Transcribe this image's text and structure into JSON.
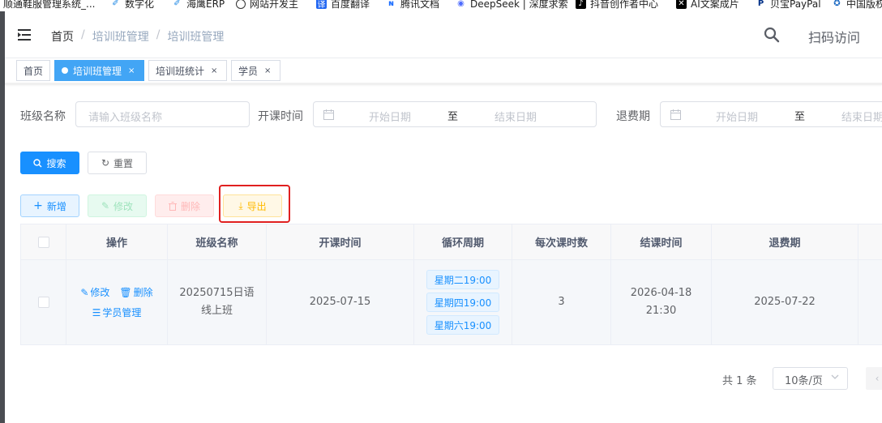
{
  "bookmarks": [
    {
      "label": "顺通鞋服管理系统_...",
      "icon": "site-icon",
      "color": "#444"
    },
    {
      "label": "数字化",
      "icon": "feather-icon",
      "color": "#1e88e5"
    },
    {
      "label": "海鹰ERP",
      "icon": "feather-icon",
      "color": "#1e88e5"
    },
    {
      "label": "网站开发主",
      "icon": "globe-icon",
      "color": "#333"
    },
    {
      "label": "百度翻译",
      "icon": "translate-icon",
      "color": "#2468f2"
    },
    {
      "label": "腾讯文档",
      "icon": "doc-icon",
      "color": "#1e6fff"
    },
    {
      "label": "DeepSeek | 深度求索",
      "icon": "deepseek-icon",
      "color": "#4d6bfe"
    },
    {
      "label": "抖音创作者中心",
      "icon": "tiktok-icon",
      "color": "#000"
    },
    {
      "label": "AI文案成片",
      "icon": "capcut-icon",
      "color": "#000"
    },
    {
      "label": "贝宝PayPal",
      "icon": "paypal-icon",
      "color": "#003087"
    },
    {
      "label": "中国版权",
      "icon": "seal-icon",
      "color": "#1565c0"
    }
  ],
  "navbar": {
    "breadcrumb": [
      "首页",
      "培训班管理",
      "培训班管理"
    ],
    "scan_label": "扫码访问"
  },
  "tags": [
    {
      "label": "首页",
      "active": false,
      "closable": false
    },
    {
      "label": "培训班管理",
      "active": true,
      "closable": true
    },
    {
      "label": "培训班统计",
      "active": false,
      "closable": true
    },
    {
      "label": "学员",
      "active": false,
      "closable": true
    }
  ],
  "tag_close_glyph": "×",
  "filters": {
    "class_name_label": "班级名称",
    "class_name_placeholder": "请输入班级名称",
    "start_time_label": "开课时间",
    "refund_label": "退费期",
    "start_date_placeholder": "开始日期",
    "end_date_placeholder": "结束日期",
    "range_separator": "至"
  },
  "buttons": {
    "search": "搜索",
    "reset": "重置",
    "add": "新增",
    "edit": "修改",
    "delete": "删除",
    "export": "导出"
  },
  "table": {
    "headers": [
      "操作",
      "班级名称",
      "开课时间",
      "循环周期",
      "每次课时数",
      "结课时间",
      "退费期"
    ],
    "rows": [
      {
        "ops": {
          "edit": "修改",
          "delete": "删除",
          "students": "学员管理"
        },
        "class_name": "20250715日语线上班",
        "start_time": "2025-07-15",
        "cycle": [
          "星期二19:00",
          "星期四19:00",
          "星期六19:00"
        ],
        "hours": "3",
        "end_time": "2026-04-18 21:30",
        "refund": "2025-07-22"
      }
    ]
  },
  "pagination": {
    "total": "共 1 条",
    "page_size": "10条/页",
    "prev_glyph": "‹"
  },
  "colors": {
    "primary": "#1890ff",
    "success": "#13ce66",
    "danger": "#ff4949",
    "warning": "#ffba00",
    "highlight": "#e02020"
  }
}
